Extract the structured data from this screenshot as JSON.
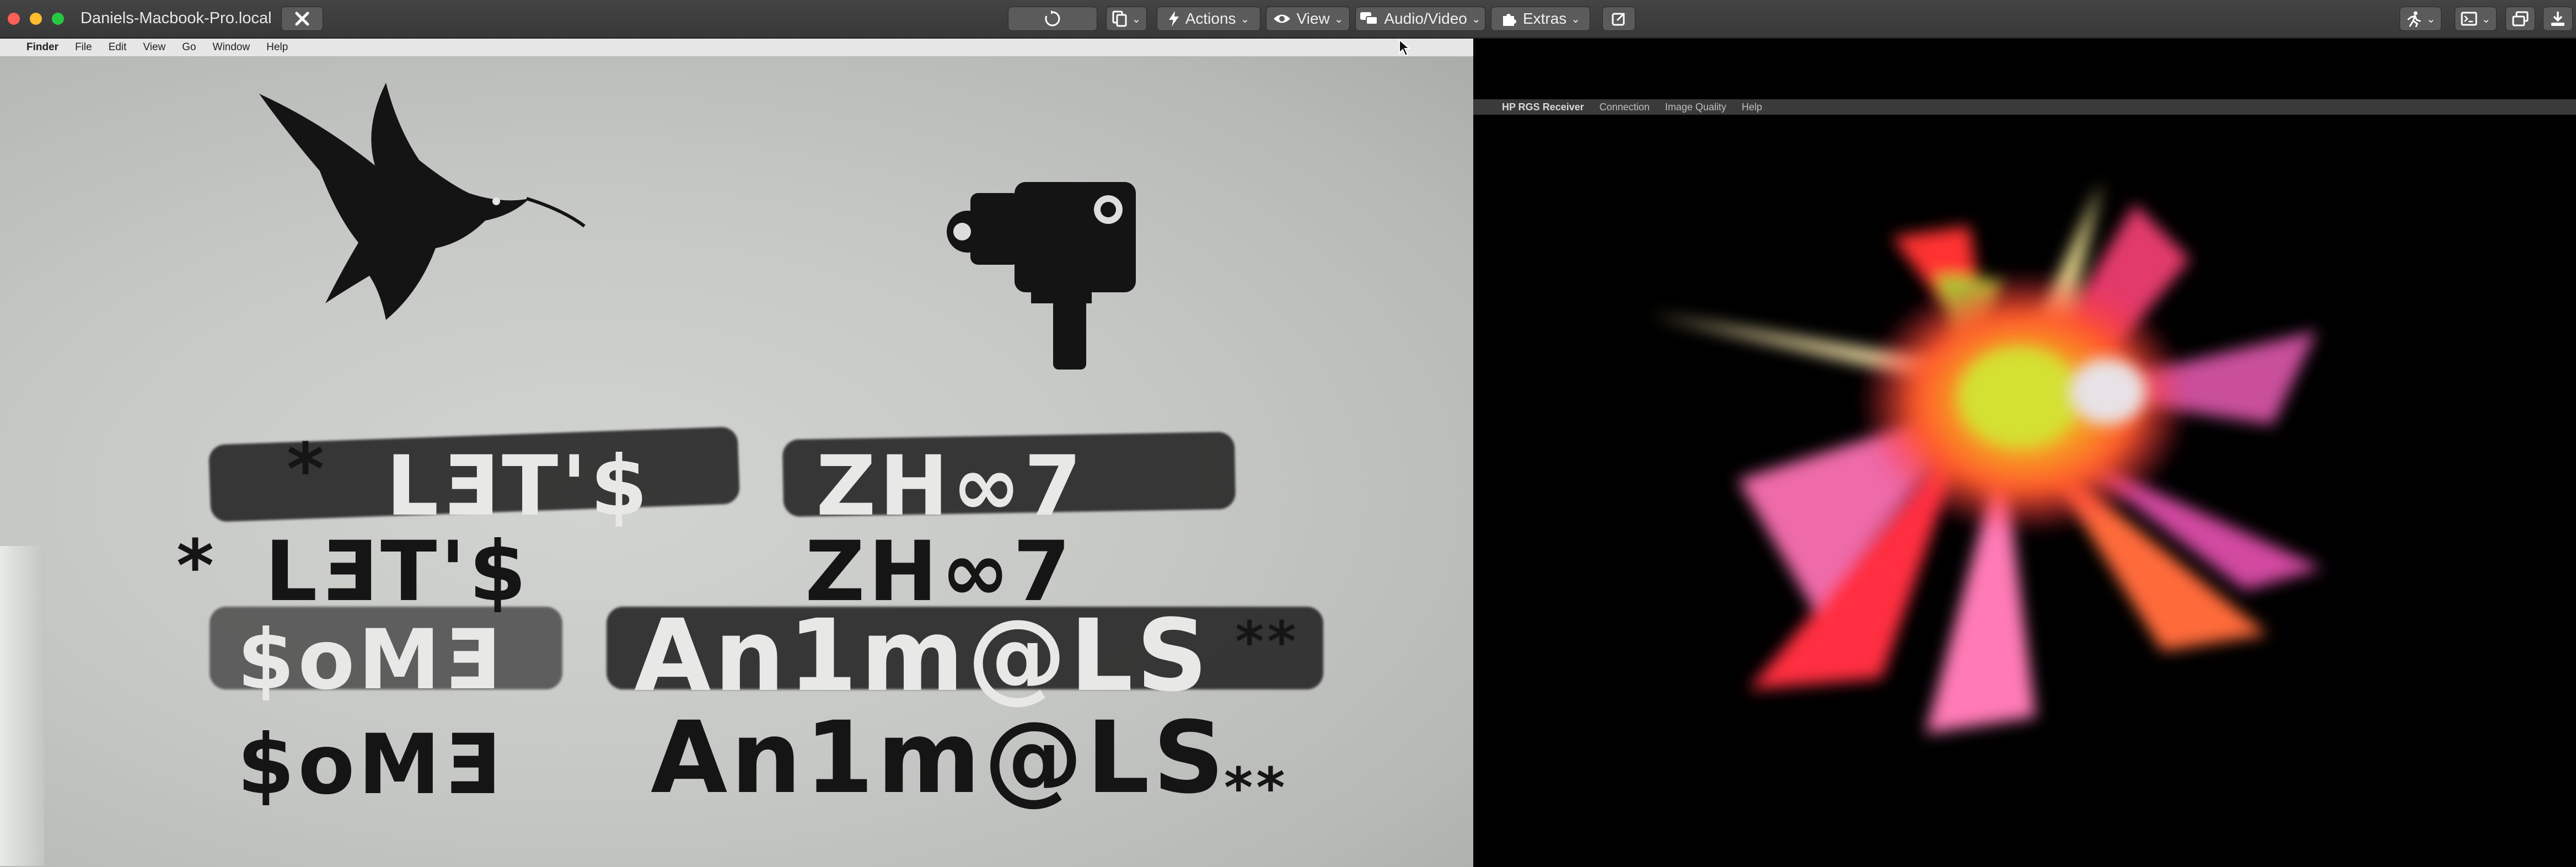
{
  "toolbar": {
    "host_title": "Daniels-Macbook-Pro.local",
    "close_icon": "x-icon",
    "reload_icon": "refresh-icon",
    "monitors_icon": "copy-screens-icon",
    "actions_label": "Actions",
    "view_label": "View",
    "audio_video_label": "Audio/Video",
    "extras_label": "Extras",
    "edit_icon": "compose-icon",
    "right_icons": [
      "run-icon",
      "terminal-icon",
      "windows-icon",
      "download-icon"
    ]
  },
  "mac_menubar": {
    "items": [
      "Finder",
      "File",
      "Edit",
      "View",
      "Go",
      "Window",
      "Help"
    ]
  },
  "graffiti": {
    "line1a": "LƎT'$",
    "line1b": "ZH∞7",
    "line2a": "LƎT'$",
    "line2b": "ZH∞7",
    "line3a": "$oMƎ",
    "line3b": "An1m@LS",
    "line4a": "$oMƎ",
    "line4b": "An1m@LS",
    "stars": "*",
    "stars_double": "**"
  },
  "hp_menubar": {
    "items": [
      "HP RGS Receiver",
      "Connection",
      "Image Quality",
      "Help"
    ]
  },
  "colors": {
    "toolbar_bg": "#3e3e3e",
    "button_bg": "#5b5b5b",
    "traffic_red": "#fe5f57",
    "traffic_yellow": "#febc2e",
    "traffic_green": "#28c840"
  }
}
